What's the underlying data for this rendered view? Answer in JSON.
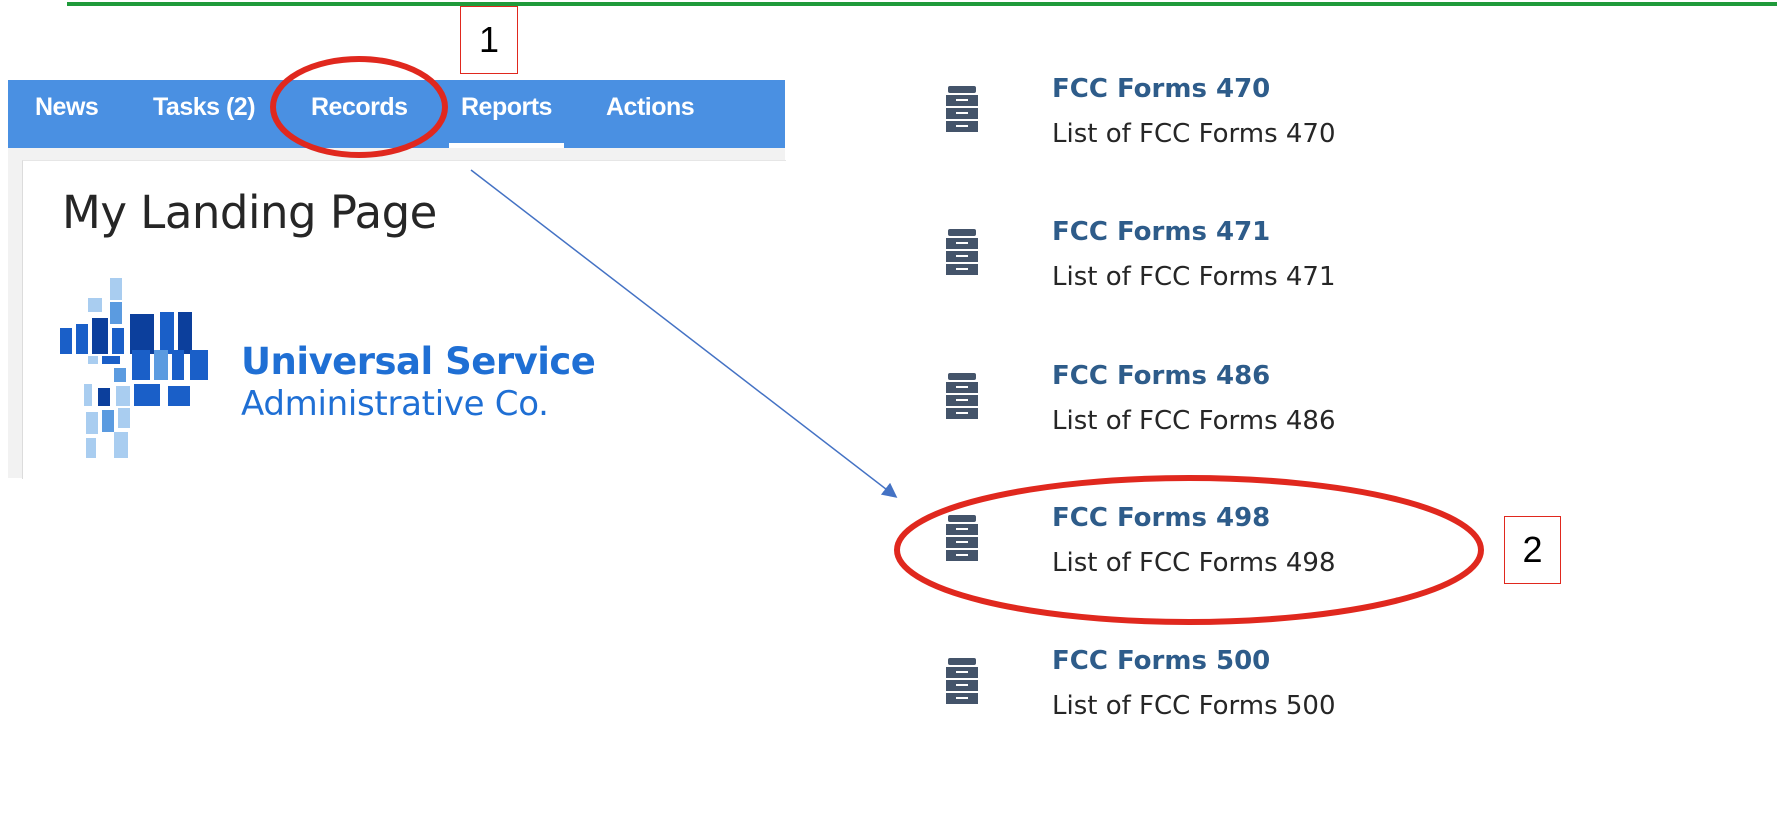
{
  "nav": {
    "items": [
      {
        "label": "News"
      },
      {
        "label": "Tasks (2)"
      },
      {
        "label": "Records"
      },
      {
        "label": "Reports"
      },
      {
        "label": "Actions"
      }
    ]
  },
  "page_title": "My Landing Page",
  "logo": {
    "line1": "Universal Service",
    "line2": "Administrative Co."
  },
  "records": [
    {
      "title": "FCC Forms 470",
      "description": "List of FCC Forms 470",
      "icon": "file-cabinet-icon"
    },
    {
      "title": "FCC Forms 471",
      "description": "List of FCC Forms 471",
      "icon": "file-cabinet-icon"
    },
    {
      "title": "FCC Forms 486",
      "description": "List of FCC Forms 486",
      "icon": "file-cabinet-icon"
    },
    {
      "title": "FCC Forms 498",
      "description": "List of FCC Forms 498",
      "icon": "file-cabinet-icon"
    },
    {
      "title": "FCC Forms 500",
      "description": "List of FCC Forms 500",
      "icon": "file-cabinet-icon"
    }
  ],
  "annotations": {
    "step1": "1",
    "step2": "2"
  },
  "colors": {
    "nav_bg": "#4a90e2",
    "highlight": "#e0281e",
    "link": "#2e5c8a",
    "logo": "#1f6fd4",
    "top_rule": "#1f9a3a"
  }
}
